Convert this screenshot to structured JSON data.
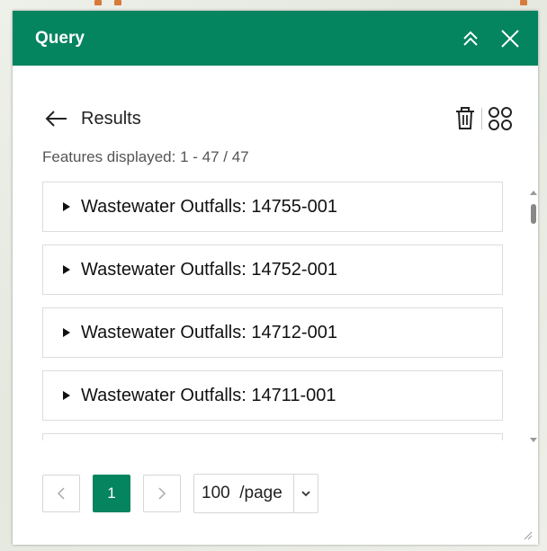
{
  "panel": {
    "title": "Query",
    "collapse_icon": "chevrons-up-icon",
    "close_icon": "close-icon"
  },
  "results": {
    "back_label": "Results",
    "features_displayed": "Features displayed: 1 - 47 / 47"
  },
  "items": [
    {
      "label": "Wastewater Outfalls: 14755-001"
    },
    {
      "label": "Wastewater Outfalls: 14752-001"
    },
    {
      "label": "Wastewater Outfalls: 14712-001"
    },
    {
      "label": "Wastewater Outfalls: 14711-001"
    }
  ],
  "pagination": {
    "current_page": "1",
    "page_size_label": "100  /page"
  },
  "colors": {
    "accent": "#04845f"
  }
}
